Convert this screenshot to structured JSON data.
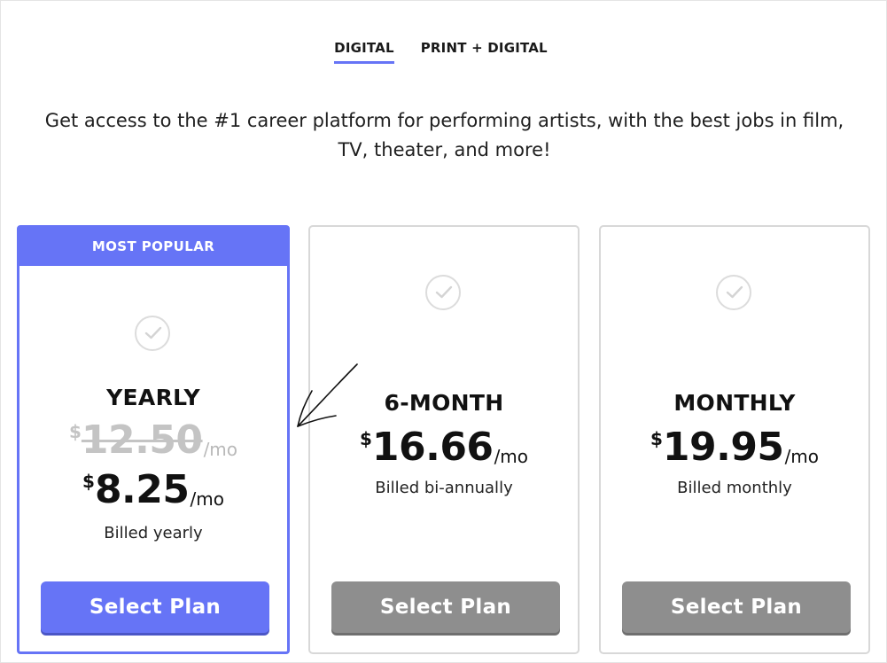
{
  "tabs": [
    {
      "label": "DIGITAL",
      "active": true
    },
    {
      "label": "PRINT + DIGITAL",
      "active": false
    }
  ],
  "intro": {
    "line1": "Get access to the #1 career platform for performing artists, with the best jobs in film,",
    "line2": "TV, theater, and more!"
  },
  "plans": {
    "yearly": {
      "badge": "MOST POPULAR",
      "name": "YEARLY",
      "old_currency": "$",
      "old_amount": "12.50",
      "old_per": "/mo",
      "currency": "$",
      "amount": "8.25",
      "per": "/mo",
      "billed": "Billed yearly",
      "button": "Select Plan"
    },
    "six_month": {
      "name": "6-MONTH",
      "currency": "$",
      "amount": "16.66",
      "per": "/mo",
      "billed": "Billed bi-annually",
      "button": "Select Plan"
    },
    "monthly": {
      "name": "MONTHLY",
      "currency": "$",
      "amount": "19.95",
      "per": "/mo",
      "billed": "Billed monthly",
      "button": "Select Plan"
    }
  },
  "colors": {
    "accent": "#6674f6",
    "button_gray": "#8e8e8e",
    "check_gray": "#dcdcdc"
  },
  "icons": [
    "check-circle-icon",
    "hand-drawn-arrow-icon"
  ]
}
